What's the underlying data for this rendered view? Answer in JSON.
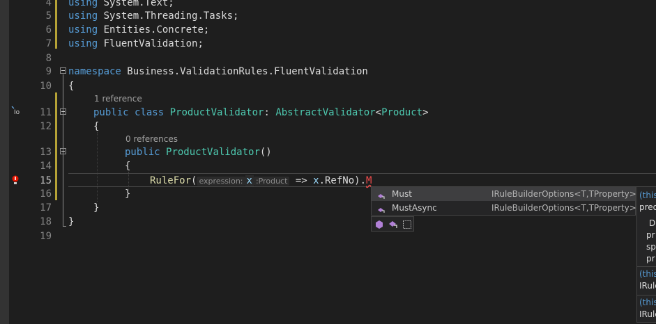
{
  "gutter": {
    "line_numbers": [
      "4",
      "5",
      "6",
      "7",
      "8",
      "9",
      "10",
      "11",
      "12",
      "13",
      "14",
      "15",
      "16",
      "17",
      "18",
      "19"
    ],
    "active_line": "15",
    "reference_icon_text": "Io",
    "lightbulb_icon": "lightbulb-icon"
  },
  "code": {
    "line4": {
      "kw": "using",
      "rest": " System.Text;"
    },
    "line5": {
      "kw": "using",
      "rest": " System.Threading.Tasks;"
    },
    "line6": {
      "kw": "using",
      "rest": " Entities.Concrete;"
    },
    "line7": {
      "kw": "using",
      "rest": " FluentValidation;"
    },
    "line9": {
      "kw": "namespace",
      "rest": " Business.ValidationRules.FluentValidation"
    },
    "line10": "{",
    "codelens_class": "1 reference",
    "line11": {
      "kw1": "public",
      "kw2": "class",
      "cls": "ProductValidator",
      "colon": ": ",
      "base": "AbstractValidator",
      "lt": "<",
      "arg": "Product",
      "gt": ">"
    },
    "line12": "{",
    "codelens_ctor": "0 references",
    "line13": {
      "kw": "public",
      "cls": "ProductValidator",
      "parens": "()"
    },
    "line14": "{",
    "line15": {
      "fn": "RuleFor",
      "open": "(",
      "hint_label": "expression:",
      "param": "x",
      "hint_type": ":Product",
      "arrow": " => ",
      "x2": "x",
      "member": ".RefNo).",
      "typed": "M"
    },
    "line16": "}",
    "line17": "}",
    "line18": "}"
  },
  "completion": {
    "items": [
      {
        "name": "Must",
        "type": "IRuleBuilderOptions<T,TProperty>",
        "selected": true
      },
      {
        "name": "MustAsync",
        "type": "IRuleBuilderOptions<T,TProperty>",
        "selected": false
      }
    ],
    "filters": [
      "class-filter-icon",
      "extension-method-filter-icon",
      "snippet-filter-icon"
    ]
  },
  "tooltip": {
    "lines": [
      "(this",
      "pred",
      "D",
      "pr",
      "sp",
      "pr",
      "(this",
      "IRule",
      "(this",
      "IRule"
    ]
  },
  "colors": {
    "background": "#1e1e1e",
    "keyword": "#569cd6",
    "type": "#4ec9b0",
    "method": "#dcdcaa",
    "change_bar": "#b5a236",
    "error": "#f14c4c"
  }
}
